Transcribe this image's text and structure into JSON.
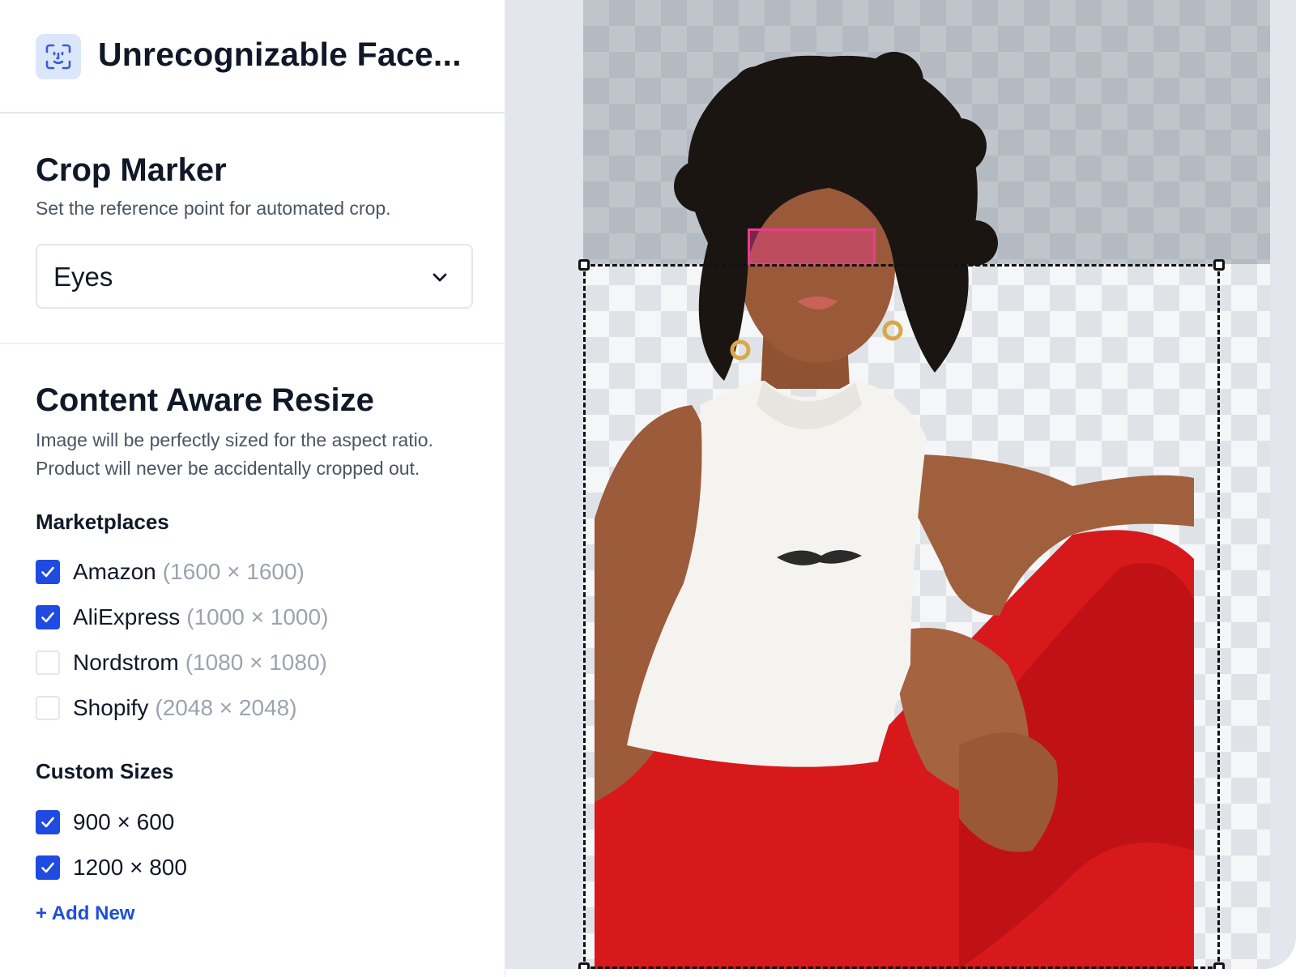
{
  "app": {
    "title": "Unrecognizable Face...",
    "icon": "face-scan-icon"
  },
  "crop_marker": {
    "title": "Crop Marker",
    "description": "Set the reference point for automated crop.",
    "selected": "Eyes"
  },
  "content_aware": {
    "title": "Content Aware Resize",
    "description_line1": "Image will be perfectly sized for the aspect ratio.",
    "description_line2": "Product will never be accidentally cropped out."
  },
  "marketplaces": {
    "heading": "Marketplaces",
    "items": [
      {
        "label": "Amazon",
        "size": "(1600 × 1600)",
        "checked": true
      },
      {
        "label": "AliExpress",
        "size": "(1000 × 1000)",
        "checked": true
      },
      {
        "label": "Nordstrom",
        "size": "(1080 × 1080)",
        "checked": false
      },
      {
        "label": "Shopify",
        "size": "(2048 × 2048)",
        "checked": false
      }
    ]
  },
  "custom_sizes": {
    "heading": "Custom Sizes",
    "items": [
      {
        "label": "900 × 600",
        "checked": true
      },
      {
        "label": "1200 × 800",
        "checked": true
      }
    ],
    "add_label": "+ Add New"
  },
  "colors": {
    "accent": "#1f4be0",
    "marker": "#ec3b8d",
    "link": "#1d4ed8"
  }
}
